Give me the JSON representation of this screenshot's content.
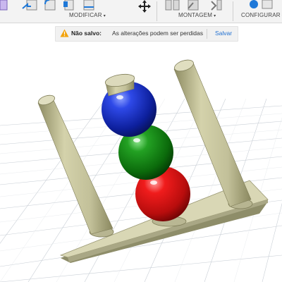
{
  "toolbar": {
    "groups": [
      {
        "label": "MODIFICAR",
        "caret": "▾"
      },
      {
        "label": "MONTAGEM",
        "caret": "▾"
      },
      {
        "label": "CONFIGURAR",
        "caret": "▾"
      }
    ],
    "icons": [
      "extrude-icon",
      "press-pull-icon",
      "fillet-icon",
      "shell-icon",
      "move-icon",
      "joint-icon",
      "as-built-joint-icon",
      "motion-link-icon",
      "parameters-icon"
    ]
  },
  "notification": {
    "status": "Não salvo:",
    "message": "As alterações podem ser perdidas",
    "action": "Salvar",
    "icon": "warning-icon"
  },
  "scene": {
    "objects": [
      "base-plate",
      "left-post",
      "right-post",
      "blue-sphere",
      "green-sphere",
      "red-sphere"
    ],
    "colors": {
      "post": "#c8c6a0",
      "blue_sphere": "#1f3dd6",
      "green_sphere": "#1c8a1c",
      "red_sphere": "#e01818"
    }
  }
}
